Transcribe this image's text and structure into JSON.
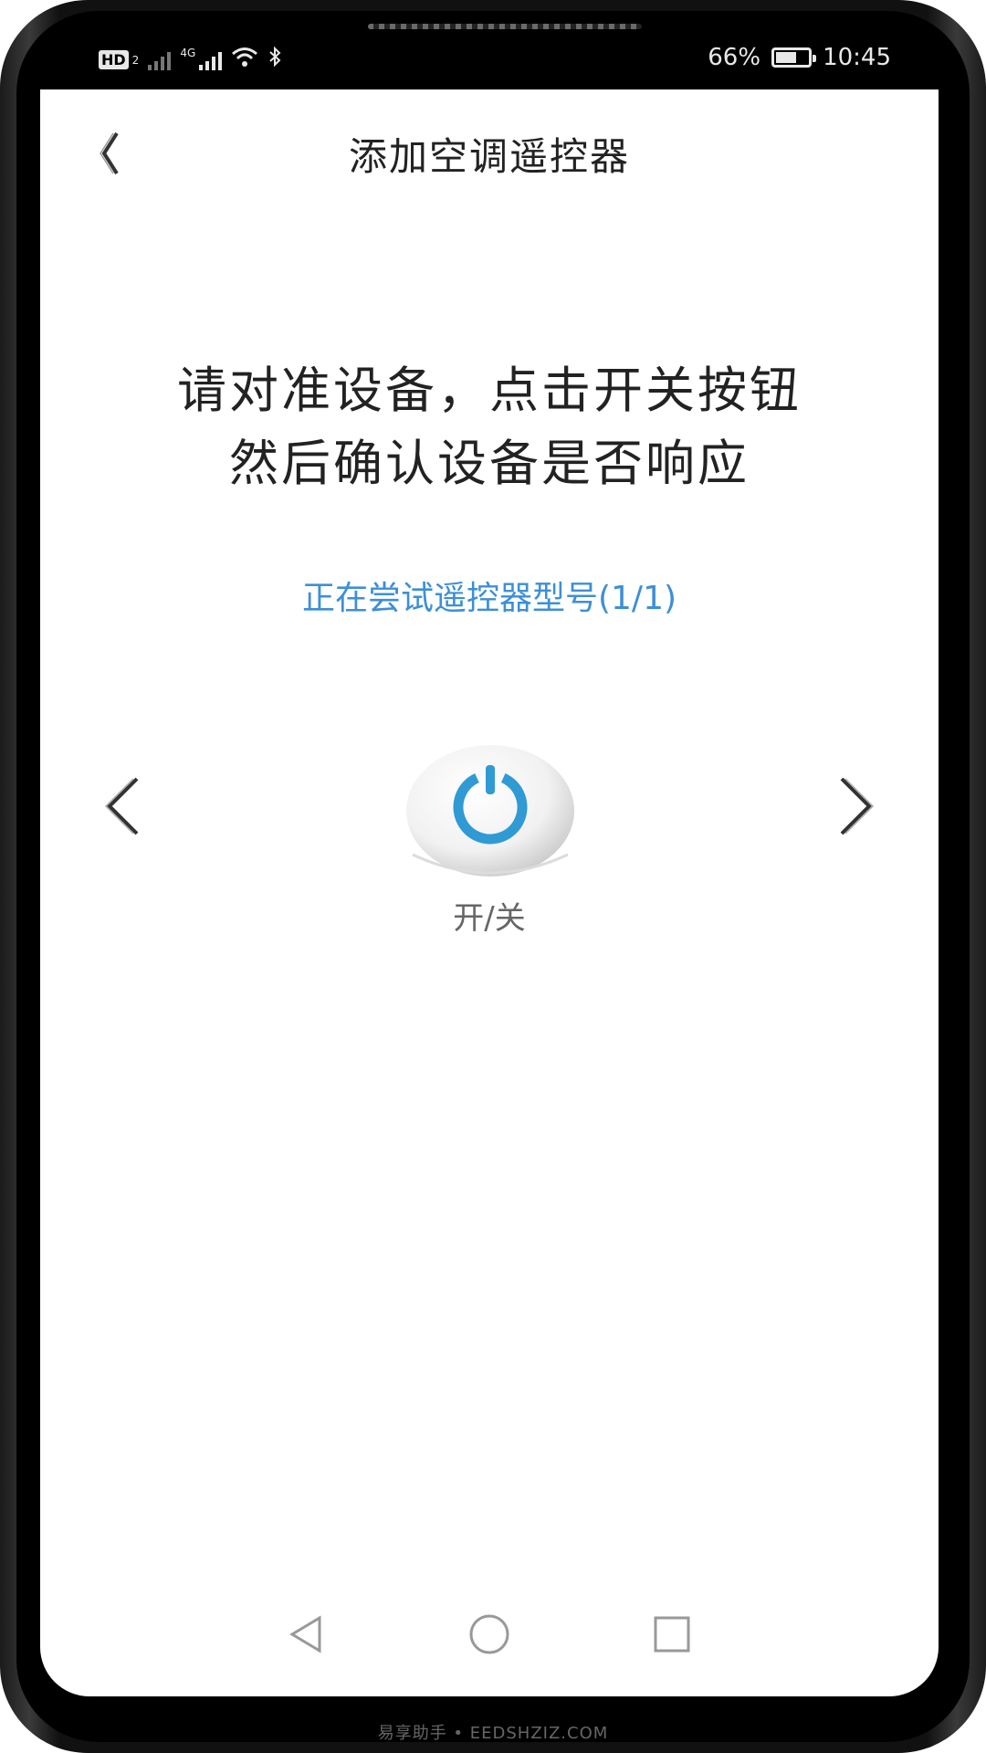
{
  "status_bar": {
    "hd_label": "HD",
    "sim_slot": "2",
    "network_type": "4G",
    "battery_percent": "66%",
    "battery_level": 0.66,
    "time": "10:45",
    "icons": [
      "hd-voice-icon",
      "signal-icon-sim1",
      "signal-icon-sim2",
      "wifi-icon",
      "bluetooth-icon",
      "battery-icon"
    ]
  },
  "header": {
    "back_icon": "chevron-left-icon",
    "title": "添加空调遥控器"
  },
  "main": {
    "instruction_line1": "请对准设备，点击开关按钮",
    "instruction_line2": "然后确认设备是否响应",
    "model_status": "正在尝试遥控器型号(1/1)",
    "prev_icon": "chevron-left-icon",
    "next_icon": "chevron-right-icon",
    "power_icon": "power-icon",
    "power_label": "开/关",
    "accent_color": "#3d8fd6"
  },
  "system_nav": {
    "icons": [
      "back-triangle-icon",
      "home-circle-icon",
      "recents-square-icon"
    ]
  },
  "watermark": "易享助手 • EEDSHZIZ.COM"
}
